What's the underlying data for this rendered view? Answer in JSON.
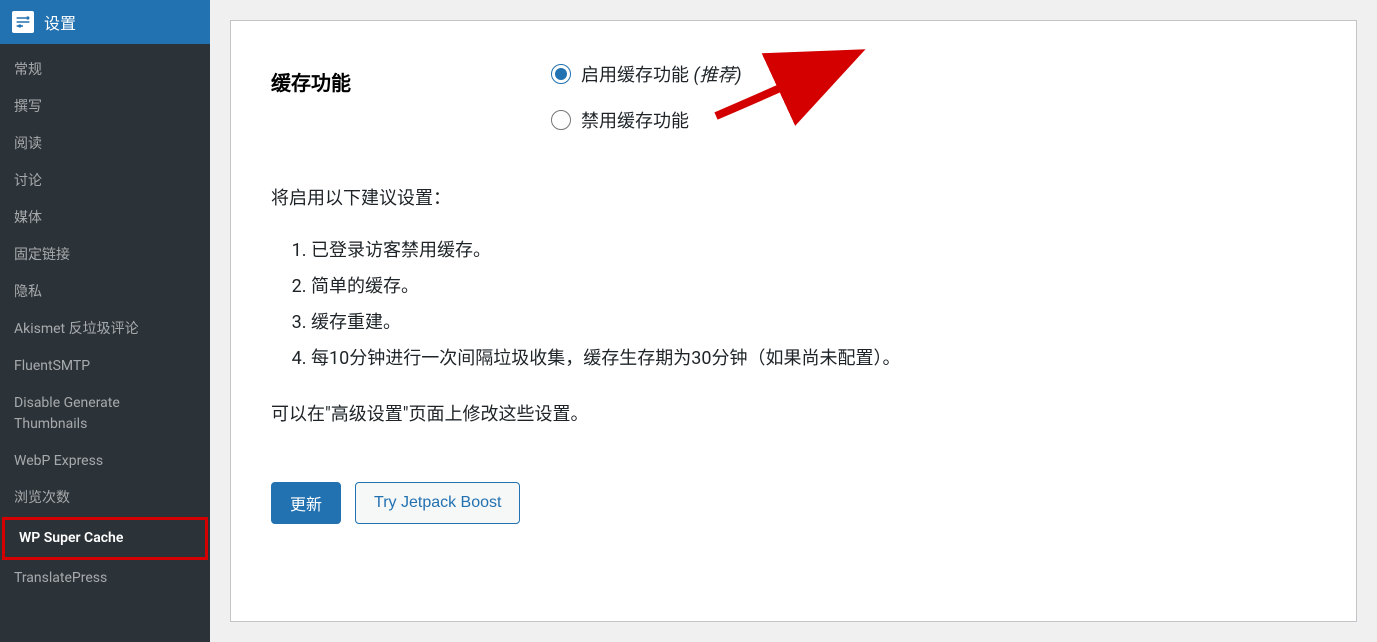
{
  "sidebar": {
    "parent_label": "设置",
    "items": [
      {
        "label": "常规"
      },
      {
        "label": "撰写"
      },
      {
        "label": "阅读"
      },
      {
        "label": "讨论"
      },
      {
        "label": "媒体"
      },
      {
        "label": "固定链接"
      },
      {
        "label": "隐私"
      },
      {
        "label": "Akismet 反垃圾评论"
      },
      {
        "label": "FluentSMTP"
      },
      {
        "label": "Disable Generate Thumbnails"
      },
      {
        "label": "WebP Express"
      },
      {
        "label": "浏览次数"
      },
      {
        "label": "WP Super Cache"
      },
      {
        "label": "TranslatePress"
      }
    ]
  },
  "main": {
    "cache_feature_label": "缓存功能",
    "enable_label": "启用缓存功能 ",
    "enable_recommend": "(推荐)",
    "disable_label": "禁用缓存功能",
    "suggest_intro": "将启用以下建议设置：",
    "suggest_items": {
      "s1": "已登录访客禁用缓存。",
      "s2": "简单的缓存。",
      "s3": "缓存重建。",
      "s4": "每10分钟进行一次间隔垃圾收集，缓存生存期为30分钟（如果尚未配置）。"
    },
    "modify_note": "可以在\"高级设置\"页面上修改这些设置。",
    "update_btn": "更新",
    "jetpack_btn": "Try Jetpack Boost"
  }
}
